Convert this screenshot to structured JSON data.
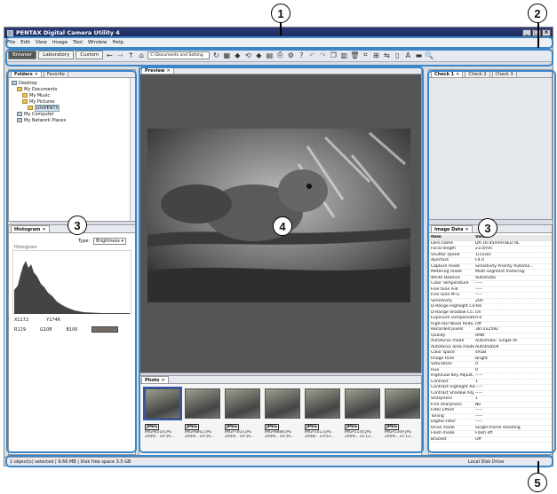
{
  "window": {
    "title": "PENTAX Digital Camera Utility 4"
  },
  "menu": [
    "File",
    "Edit",
    "View",
    "Image",
    "Tool",
    "Window",
    "Help"
  ],
  "toolbar": {
    "modes": [
      "Browser",
      "Laboratory",
      "Custom"
    ],
    "path": "C:\\Documents and Setting"
  },
  "folders_panel": {
    "tabs": [
      "Folders",
      "Favorite"
    ],
    "tree": [
      "Desktop",
      "My Documents",
      "My Music",
      "My Pictures",
      "100PENTX",
      "My Computer",
      "My Network Places"
    ]
  },
  "histogram_panel": {
    "tab": "Histogram",
    "type_label": "Type:",
    "type_value": "Brightness",
    "chart_label": "Histogram",
    "coords": {
      "x": "X1172",
      "y": "Y1746"
    },
    "rgb": {
      "r": "R119",
      "g": "G108",
      "b": "B100"
    }
  },
  "preview_panel": {
    "tab": "Preview"
  },
  "check_panel": {
    "tabs": [
      "Check 1",
      "Check 2",
      "Check 3"
    ]
  },
  "image_data_panel": {
    "tab": "Image Data",
    "header": {
      "item": "Item",
      "value": "Value"
    },
    "rows": [
      [
        "Lens name",
        "DA 16-45mmF4ED AL"
      ],
      [
        "Focal length",
        "23.0mm"
      ],
      [
        "Shutter speed",
        "1/15sec"
      ],
      [
        "Aperture",
        "F4.0"
      ],
      [
        "Capture mode",
        "Sensitivity Priority Automa..."
      ],
      [
        "Metering mode",
        "Multi-segment metering"
      ],
      [
        "White Balance",
        "Automatic"
      ],
      [
        "Color Temperature",
        "-----"
      ],
      [
        "Fine tune A-B",
        "-----"
      ],
      [
        "Fine tune M-G",
        "-----"
      ],
      [
        "Sensitivity",
        "200"
      ],
      [
        "D-Range Highlight Co...",
        "Yes"
      ],
      [
        "D-Range Shadow Co...",
        "On"
      ],
      [
        "Exposure compensation",
        "0.0"
      ],
      [
        "High-ISO Noise Redu...",
        "Off"
      ],
      [
        "Recorded pixels",
        "3872x2592"
      ],
      [
        "Quality",
        "RAW"
      ],
      [
        "Autofocus mode",
        "Automatic: Single AF"
      ],
      [
        "Autofocus area mode",
        "AutomaticK"
      ],
      [
        "Color space",
        "sRGB"
      ],
      [
        "Image tone",
        "Bright"
      ],
      [
        "Saturation",
        "0"
      ],
      [
        "Hue",
        "0"
      ],
      [
        "High/Low Key Adjust...",
        "-----"
      ],
      [
        "Contrast",
        "1"
      ],
      [
        "Contrast Highlight Ad...",
        "-----"
      ],
      [
        "Contrast Shadow Adj...",
        "-----"
      ],
      [
        "Sharpness",
        "1"
      ],
      [
        "Fine Sharpness",
        "No"
      ],
      [
        "Filter Effect",
        "-----"
      ],
      [
        "Toning",
        "-----"
      ],
      [
        "Digital Filter",
        "-----"
      ],
      [
        "Drive mode",
        "Single-frame shooting"
      ],
      [
        "Flash mode",
        "Flash off"
      ],
      [
        "Bracket",
        "Off"
      ]
    ]
  },
  "thumbnail_panel": {
    "tab": "Photo",
    "items": [
      {
        "badge": "JPEG",
        "file": "IMGP8518.JPG",
        "date": "2009/..  19:39..."
      },
      {
        "badge": "JPEG",
        "file": "IMGP8862.JPG",
        "date": "2009/..  19:39..."
      },
      {
        "badge": "JPEG",
        "file": "IMGP7003.JPG",
        "date": "2009/..  19:39..."
      },
      {
        "badge": "JPEG",
        "file": "IMGP8888.JPG",
        "date": "2009/..  19:39..."
      },
      {
        "badge": "JPEG",
        "file": "IMGP1013.JPG",
        "date": "2008/..  23:03..."
      },
      {
        "badge": "JPEG",
        "file": "IMGP1144.JPG",
        "date": "2009/..  21:12..."
      },
      {
        "badge": "JPEG",
        "file": "IMGP1369.JPG",
        "date": "2009/..  21:12..."
      }
    ]
  },
  "status": {
    "left": "1 object(s) selected | 9.66 MB | Disk free space 3.5 GB",
    "right": "Local Disk Drive"
  },
  "callouts": [
    "1",
    "2",
    "3",
    "3",
    "4",
    "5"
  ]
}
